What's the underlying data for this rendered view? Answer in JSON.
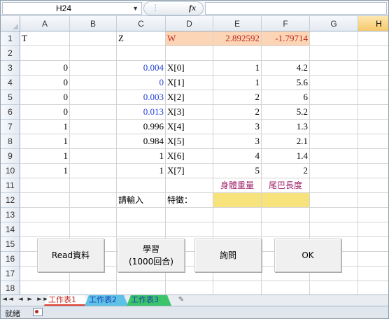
{
  "namebox": {
    "value": "H24"
  },
  "formula_bar": {
    "fx_symbol": "fx",
    "value": ""
  },
  "columns": [
    "A",
    "B",
    "C",
    "D",
    "E",
    "F",
    "G",
    "H"
  ],
  "active_column": "H",
  "rows": [
    "1",
    "2",
    "3",
    "4",
    "5",
    "6",
    "7",
    "8",
    "9",
    "10",
    "11",
    "12",
    "13",
    "14",
    "15",
    "16",
    "17",
    "18"
  ],
  "cells": {
    "A1": "T",
    "C1": "Z",
    "D1": "W",
    "E1": "2.892592",
    "F1": "-1.79714",
    "A3": "0",
    "C3": "0.004",
    "D3": "X[0]",
    "E3": "1",
    "F3": "4.2",
    "A4": "0",
    "C4": "0",
    "D4": "X[1]",
    "E4": "1",
    "F4": "5.6",
    "A5": "0",
    "C5": "0.003",
    "D5": "X[2]",
    "E5": "2",
    "F5": "6",
    "A6": "0",
    "C6": "0.013",
    "D6": "X[3]",
    "E6": "2",
    "F6": "5.2",
    "A7": "1",
    "C7": "0.996",
    "D7": "X[4]",
    "E7": "3",
    "F7": "1.3",
    "A8": "1",
    "C8": "0.984",
    "D8": "X[5]",
    "E8": "3",
    "F8": "2.1",
    "A9": "1",
    "C9": "1",
    "D9": "X[6]",
    "E9": "4",
    "F9": "1.4",
    "A10": "1",
    "C10": "1",
    "D10": "X[7]",
    "E10": "5",
    "F10": "2",
    "E11": "身體重量",
    "F11": "尾巴長度",
    "C12": "請輸入",
    "D12": "特徵："
  },
  "buttons": {
    "read": {
      "label": "Read資料"
    },
    "learn": {
      "line1": "學習",
      "line2": "(1000回合)"
    },
    "ask": {
      "label": "詢問"
    },
    "ok": {
      "label": "OK"
    }
  },
  "sheet_tabs": {
    "nav": "◄◄ ◄ ► ►►",
    "tabs": [
      "工作表1",
      "工作表2",
      "工作表3"
    ],
    "active": "工作表1"
  },
  "status": {
    "ready": "就緒"
  },
  "colors": {
    "peach_fill": "#fbd5b5",
    "yellow_fill": "#f8e27c",
    "blue_text": "#1f3fd6",
    "red_text": "#c0281e",
    "purple_text": "#a0226a"
  }
}
